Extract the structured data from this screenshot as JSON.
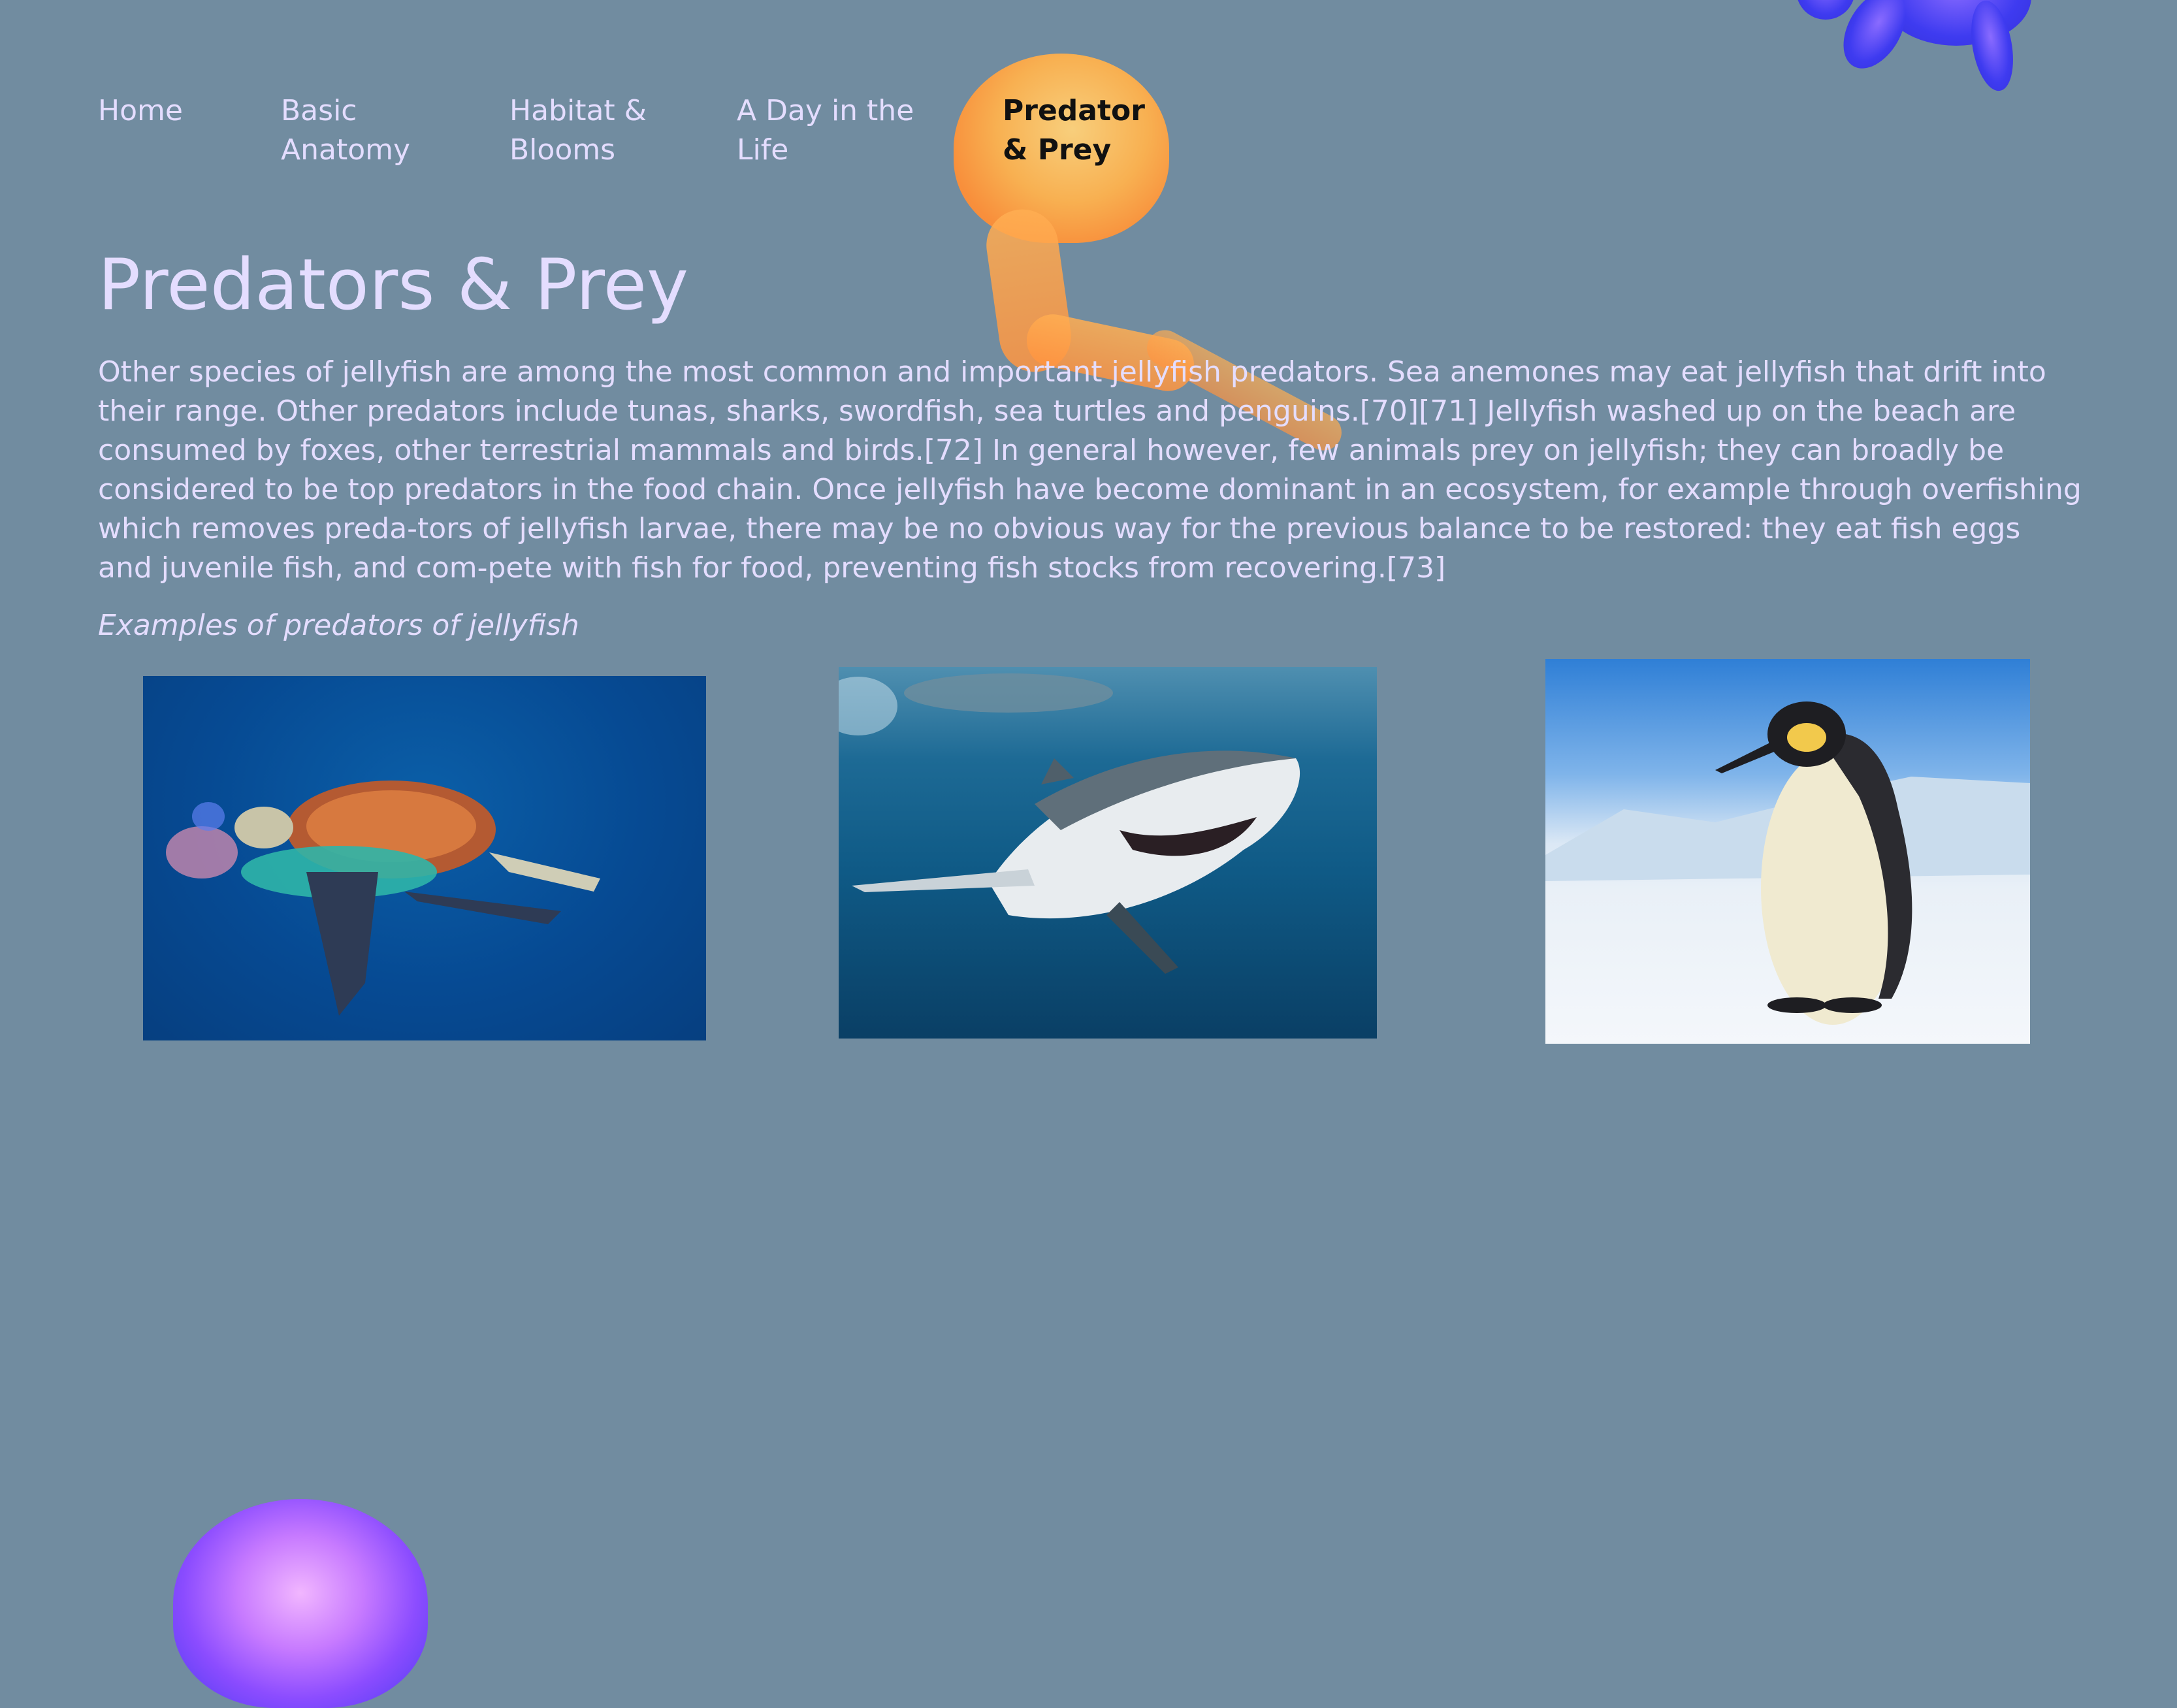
{
  "nav": {
    "items": [
      {
        "label": "Home",
        "active": false
      },
      {
        "label": "Basic\nAnatomy",
        "active": false
      },
      {
        "label": "Habitat &\nBlooms",
        "active": false
      },
      {
        "label": "A Day in the\nLife",
        "active": false
      },
      {
        "label": "Predator\n& Prey",
        "active": true
      }
    ]
  },
  "main": {
    "title": "Predators & Prey",
    "paragraph": "Other species of jellyfish are among the most common and important jellyfish predators. Sea anemones may eat jellyfish that drift into their range. Other predators include tunas, sharks, swordfish, sea turtles and penguins.[70][71] Jellyfish washed up on the beach are consumed by foxes, other terrestrial mammals and birds.[72] In general however, few animals prey on jellyfish; they can broadly be considered to be top predators in the food chain. Once jellyfish have become dominant in an ecosystem, for example through overfishing which removes preda-tors of jellyfish larvae, there may be no obvious way for the previous balance to be restored: they eat fish eggs and juvenile fish, and com-pete with fish for food, preventing fish stocks from recovering.[73]",
    "caption": "Examples of predators of jellyfish"
  },
  "images": [
    {
      "subject": "sea turtle eating a jellyfish"
    },
    {
      "subject": "great white shark"
    },
    {
      "subject": "emperor penguin"
    }
  ],
  "decorations": [
    "orange-jellyfish",
    "blue-jellyfish",
    "purple-jellyfish"
  ],
  "colors": {
    "background": "#718ca0",
    "text": "#e4ddff",
    "active_nav": "#111111",
    "jelly_orange": "#ffb24d",
    "jelly_blue": "#3e3bf0",
    "jelly_purple": "#c77aff"
  }
}
